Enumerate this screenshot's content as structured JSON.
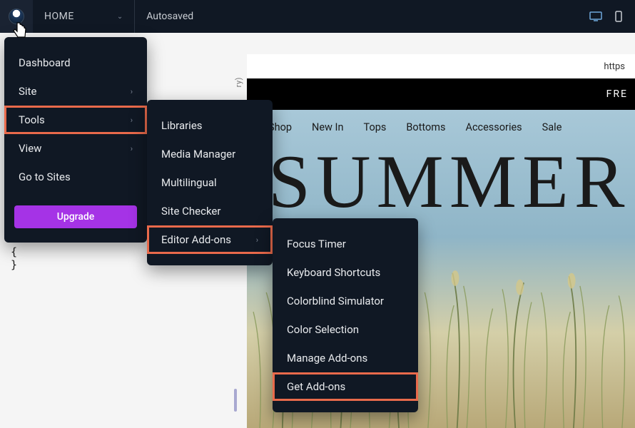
{
  "topbar": {
    "home_label": "HOME",
    "autosaved": "Autosaved"
  },
  "menu_main": {
    "items": [
      {
        "label": "Dashboard",
        "has_sub": false,
        "hl": false
      },
      {
        "label": "Site",
        "has_sub": true,
        "hl": false
      },
      {
        "label": "Tools",
        "has_sub": true,
        "hl": true
      },
      {
        "label": "View",
        "has_sub": true,
        "hl": false
      },
      {
        "label": "Go to Sites",
        "has_sub": false,
        "hl": false
      }
    ],
    "upgrade": "Upgrade"
  },
  "menu_tools": {
    "items": [
      {
        "label": "Libraries",
        "has_sub": false,
        "hl": false
      },
      {
        "label": "Media Manager",
        "has_sub": false,
        "hl": false
      },
      {
        "label": "Multilingual",
        "has_sub": false,
        "hl": false
      },
      {
        "label": "Site Checker",
        "has_sub": false,
        "hl": false
      },
      {
        "label": "Editor Add-ons",
        "has_sub": true,
        "hl": true
      }
    ]
  },
  "menu_addons": {
    "items": [
      {
        "label": "Focus Timer",
        "hl": false
      },
      {
        "label": "Keyboard Shortcuts",
        "hl": false
      },
      {
        "label": "Colorblind Simulator",
        "hl": false
      },
      {
        "label": "Color Selection",
        "hl": false
      },
      {
        "label": "Manage Add-ons",
        "hl": false
      },
      {
        "label": "Get Add-ons",
        "hl": true
      }
    ]
  },
  "preview": {
    "url_fragment": "https",
    "promo": "FRE",
    "nav": [
      "Shop",
      "New In",
      "Tops",
      "Bottoms",
      "Accessories",
      "Sale"
    ],
    "hero": "SUMMER"
  },
  "side_label": "ry)"
}
